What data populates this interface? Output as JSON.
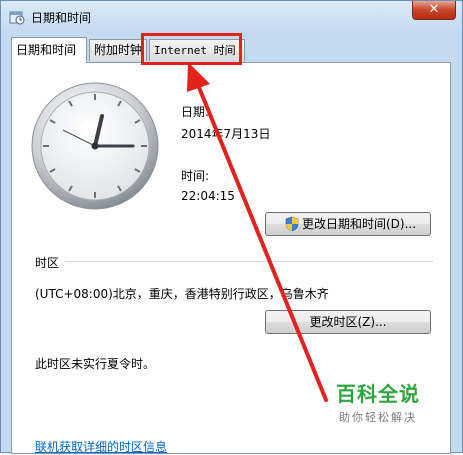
{
  "window": {
    "title": "日期和时间"
  },
  "tabs": [
    {
      "label": "日期和时间"
    },
    {
      "label": "附加时钟"
    },
    {
      "label": "Internet 时间"
    }
  ],
  "date": {
    "label": "日期:",
    "value": "2014年7月13日"
  },
  "time": {
    "label": "时间:",
    "value": "22:04:15"
  },
  "buttons": {
    "change_datetime": "更改日期和时间(D)...",
    "change_timezone": "更改时区(Z)..."
  },
  "timezone": {
    "section_label": "时区",
    "value": "(UTC+08:00)北京，重庆，香港特别行政区，乌鲁木齐",
    "dst_note": "此时区未实行夏令时。"
  },
  "link": {
    "text": "联机获取详细的时区信息"
  },
  "watermark": {
    "main": "百科全说",
    "sub": "助你轻松解决"
  },
  "colors": {
    "highlight": "#e3211d",
    "link": "#0066cc",
    "watermark": "#2fa63c"
  }
}
